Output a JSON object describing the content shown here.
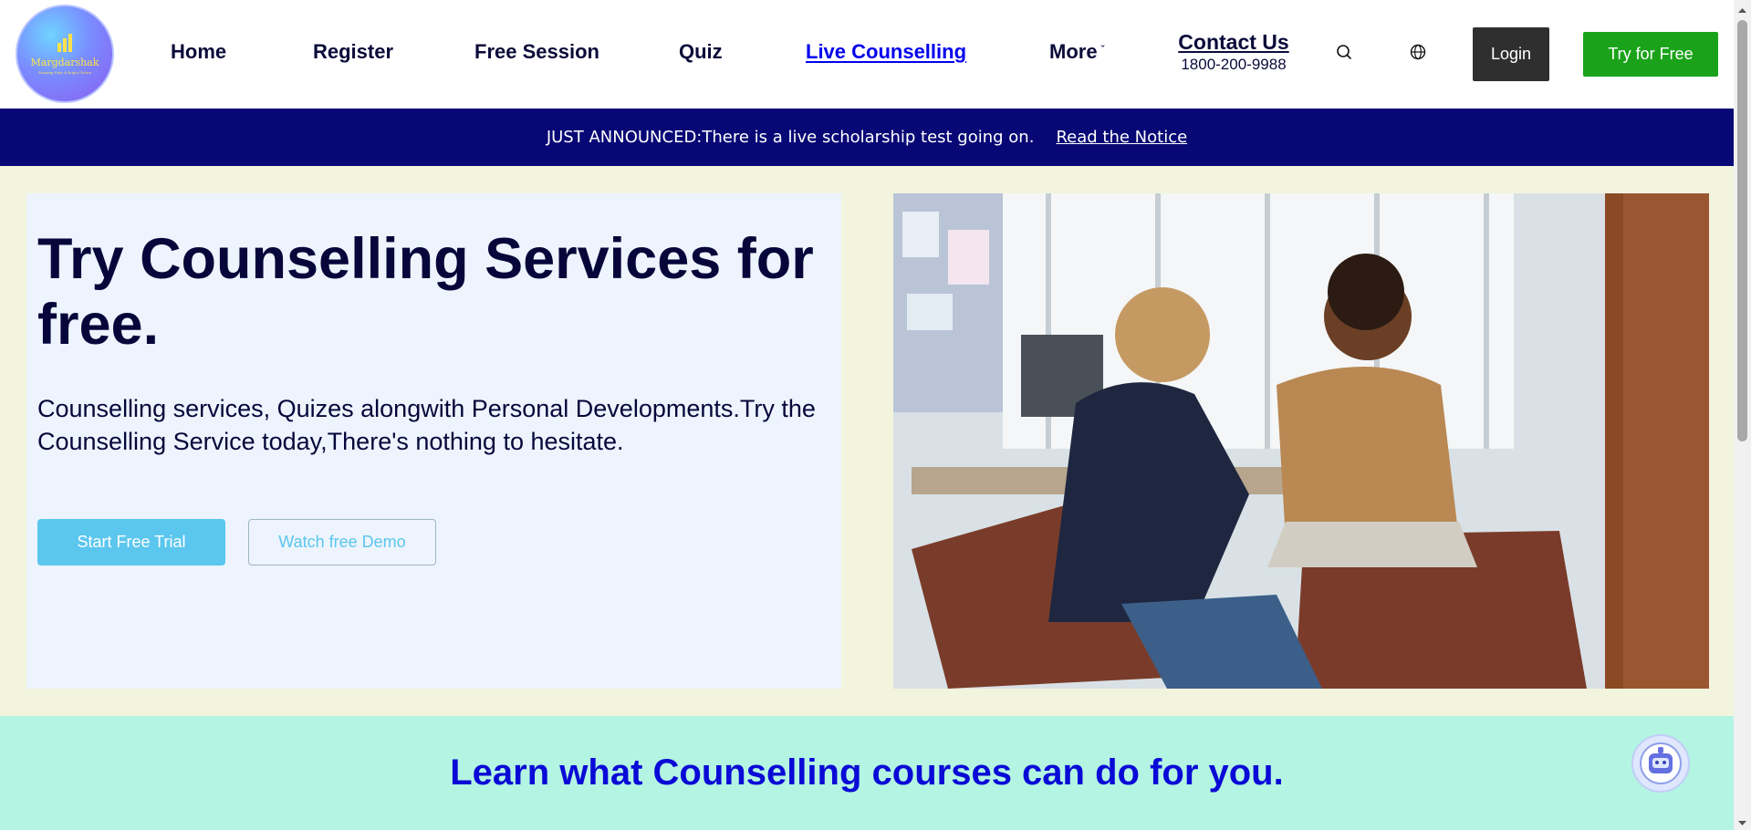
{
  "brand": {
    "name": "Margdarshak",
    "tagline": "Showing Path & Bright Future",
    "logo_color": "#ffe14a"
  },
  "nav": {
    "items": [
      {
        "label": "Home",
        "active": false
      },
      {
        "label": "Register",
        "active": false
      },
      {
        "label": "Free Session",
        "active": false
      },
      {
        "label": "Quiz",
        "active": false
      },
      {
        "label": "Live Counselling",
        "active": true
      },
      {
        "label": "More",
        "active": false
      }
    ],
    "more_icon": "chevron-down-icon"
  },
  "contact": {
    "title": "Contact Us",
    "phone": "1800-200-9988"
  },
  "header_actions": {
    "search_icon": "search-icon",
    "language_icon": "globe-icon",
    "login_label": "Login",
    "try_label": "Try for Free",
    "login_color": "#2f2f2f",
    "try_color": "#1aa31a"
  },
  "announcement": {
    "text": "JUST ANNOUNCED:There is a live scholarship test going on.",
    "link": "Read the Notice",
    "background": "#070775"
  },
  "hero": {
    "title": "Try Counselling Services for free.",
    "subtitle": "Counselling services, Quizes alongwith Personal Developments.Try the Counselling Service today,There's nothing to hesitate.",
    "primary_button": "Start Free Trial",
    "secondary_button": "Watch free Demo",
    "accent": "#5bc6ee",
    "image_subject": "counsellor-session-photo"
  },
  "section": {
    "title": "Learn what Counselling courses can do for you.",
    "title_color": "#0a0ad6",
    "background": "#b3f4e2",
    "chat_icon": "chatbot-icon"
  }
}
